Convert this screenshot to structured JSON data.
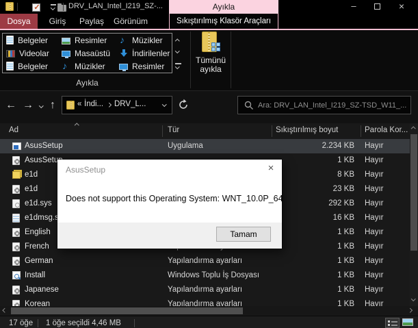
{
  "window": {
    "title": "DRV_LAN_Intel_I219_SZ-...",
    "controls": {
      "minimize": "–",
      "maximize": "",
      "close": "×"
    }
  },
  "contextual": {
    "header": "Ayıkla",
    "tab": "Sıkıştırılmış Klasör Araçları"
  },
  "tabs": {
    "file": "Dosya",
    "home": "Giriş",
    "share": "Paylaş",
    "view": "Görünüm"
  },
  "help_label": "?",
  "ribbon": {
    "gallery": [
      {
        "label": "Belgeler",
        "icon": "document-icon"
      },
      {
        "label": "Resimler",
        "icon": "picture-icon"
      },
      {
        "label": "Müzikler",
        "icon": "music-icon"
      },
      {
        "label": "Videolar",
        "icon": "video-icon"
      },
      {
        "label": "Masaüstü",
        "icon": "desktop-icon"
      },
      {
        "label": "İndirilenler",
        "icon": "download-icon"
      },
      {
        "label": "Belgeler",
        "icon": "document-icon"
      },
      {
        "label": "Müzikler",
        "icon": "music-icon"
      },
      {
        "label": "Resimler",
        "icon": "monitor-picture-icon"
      }
    ],
    "extract_all_label": "Tümünü\nayıkla",
    "group_label": "Ayıkla"
  },
  "addressbar": {
    "breadcrumb_overflow": "«",
    "crumb1": "İndi...",
    "crumb2": "DRV_L...",
    "search_placeholder": "Ara: DRV_LAN_Intel_I219_SZ-TSD_W11_...",
    "search_value": ""
  },
  "columns": {
    "name": "Ad",
    "type": "Tür",
    "size": "Sıkıştırılmış boyut",
    "password": "Parola Kor..."
  },
  "rows": [
    {
      "name": "AsusSetup",
      "type": "Uygulama",
      "size": "2.234 KB",
      "password": "Hayır",
      "icon": "application-icon"
    },
    {
      "name": "AsusSetup",
      "type": "",
      "size": "1 KB",
      "password": "Hayır",
      "icon": "config-file-icon"
    },
    {
      "name": "e1d",
      "type": "",
      "size": "8 KB",
      "password": "Hayır",
      "icon": "catalog-file-icon"
    },
    {
      "name": "e1d",
      "type": "",
      "size": "23 KB",
      "password": "Hayır",
      "icon": "config-file-icon"
    },
    {
      "name": "e1d.sys",
      "type": "",
      "size": "292 KB",
      "password": "Hayır",
      "icon": "system-file-icon"
    },
    {
      "name": "e1dmsg.sys",
      "type": "",
      "size": "16 KB",
      "password": "Hayır",
      "icon": "text-file-icon"
    },
    {
      "name": "English",
      "type": "",
      "size": "1 KB",
      "password": "Hayır",
      "icon": "config-file-icon"
    },
    {
      "name": "French",
      "type": "Yapılandırma ayarları",
      "size": "1 KB",
      "password": "Hayır",
      "icon": "config-file-icon"
    },
    {
      "name": "German",
      "type": "Yapılandırma ayarları",
      "size": "1 KB",
      "password": "Hayır",
      "icon": "config-file-icon"
    },
    {
      "name": "Install",
      "type": "Windows Toplu İş Dosyası",
      "size": "1 KB",
      "password": "Hayır",
      "icon": "batch-file-icon"
    },
    {
      "name": "Japanese",
      "type": "Yapılandırma ayarları",
      "size": "1 KB",
      "password": "Hayır",
      "icon": "config-file-icon"
    },
    {
      "name": "Korean",
      "type": "Yapılandırma ayarları",
      "size": "1 KB",
      "password": "Hayır",
      "icon": "config-file-icon"
    }
  ],
  "dialog": {
    "title": "AsusSetup",
    "message": "Does not support this Operating System: WNT_10.0P_64",
    "ok_label": "Tamam",
    "close": "×"
  },
  "statusbar": {
    "item_count": "17 öğe",
    "selection": "1 öğe seçildi  4,46 MB"
  },
  "colors": {
    "contextual_pink": "#fbd3e0",
    "pink_line": "#f6bed2",
    "file_tab_red": "#9d3a44",
    "help_blue": "#2e7cd6",
    "selected_row": "#383b3f",
    "list_bg": "#191919",
    "dialog_bg": "#ffffff",
    "dialog_footer": "#f0f0f0",
    "button_face": "#e1e1e1"
  }
}
